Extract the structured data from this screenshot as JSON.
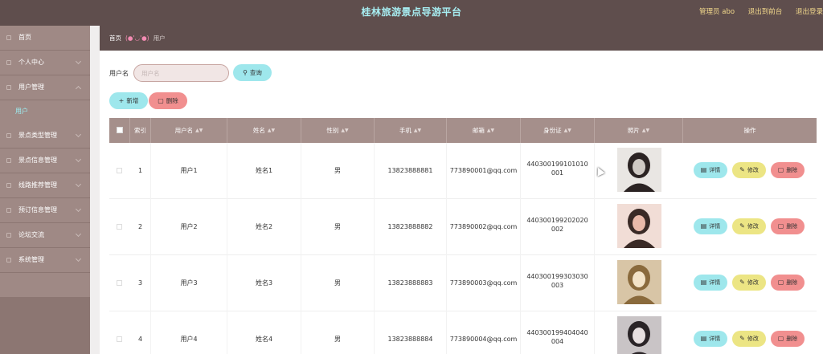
{
  "header": {
    "title": "桂林旅游景点导游平台",
    "admin": "管理员 abo",
    "back_to_front": "退出到前台",
    "logout": "退出登录"
  },
  "sidebar": {
    "items": [
      {
        "label": "首页"
      },
      {
        "label": "个人中心"
      },
      {
        "label": "用户管理"
      },
      {
        "label": "景点类型管理"
      },
      {
        "label": "景点信息管理"
      },
      {
        "label": "线路推荐管理"
      },
      {
        "label": "预订信息管理"
      },
      {
        "label": "论坛交流"
      },
      {
        "label": "系统管理"
      }
    ],
    "sub_item": "用户"
  },
  "breadcrumb": {
    "home": "首页",
    "separator": "(●'◡'●)",
    "current": "用户"
  },
  "search": {
    "label": "用户名",
    "placeholder": "用户名",
    "query_button": "查询"
  },
  "toolbar": {
    "add": "新增",
    "delete": "删除"
  },
  "table": {
    "columns": [
      "索引",
      "用户名",
      "姓名",
      "性别",
      "手机",
      "邮箱",
      "身份证",
      "照片",
      "操作"
    ],
    "rows": [
      {
        "index": "1",
        "username": "用户1",
        "name": "姓名1",
        "gender": "男",
        "phone": "13823888881",
        "email": "773890001@qq.com",
        "idcard": "440300199101010001"
      },
      {
        "index": "2",
        "username": "用户2",
        "name": "姓名2",
        "gender": "男",
        "phone": "13823888882",
        "email": "773890002@qq.com",
        "idcard": "440300199202020002"
      },
      {
        "index": "3",
        "username": "用户3",
        "name": "姓名3",
        "gender": "男",
        "phone": "13823888883",
        "email": "773890003@qq.com",
        "idcard": "440300199303030003"
      },
      {
        "index": "4",
        "username": "用户4",
        "name": "姓名4",
        "gender": "男",
        "phone": "13823888884",
        "email": "773890004@qq.com",
        "idcard": "440300199404040004"
      }
    ],
    "actions": {
      "detail": "详情",
      "edit": "修改",
      "delete": "删除"
    }
  },
  "colors": {
    "topbar": "#5f4e4d",
    "title": "#a7eef2",
    "sidebar": "#9f8985",
    "table_header": "#a58f8b",
    "btn_cyan": "#9ee7ec",
    "btn_red": "#f18f8f",
    "btn_yellow": "#ece584"
  }
}
